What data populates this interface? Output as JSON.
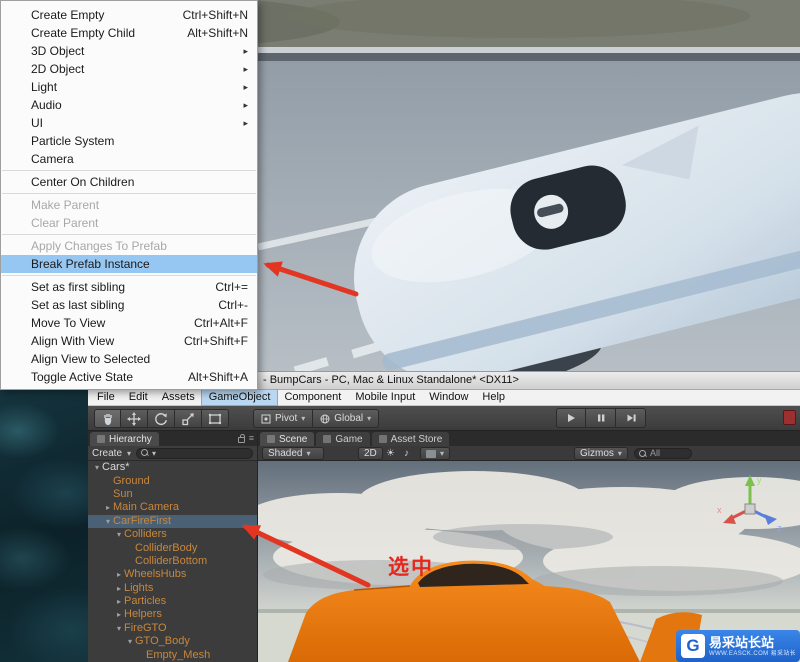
{
  "window": {
    "title": "- BumpCars - PC, Mac & Linux Standalone* <DX11>"
  },
  "menu_bar": {
    "items": [
      "File",
      "Edit",
      "Assets",
      "GameObject",
      "Component",
      "Mobile Input",
      "Window",
      "Help"
    ],
    "active": "GameObject"
  },
  "context_menu": {
    "items": [
      {
        "label": "Create Empty",
        "shortcut": "Ctrl+Shift+N"
      },
      {
        "label": "Create Empty Child",
        "shortcut": "Alt+Shift+N"
      },
      {
        "label": "3D Object",
        "submenu": true
      },
      {
        "label": "2D Object",
        "submenu": true
      },
      {
        "label": "Light",
        "submenu": true
      },
      {
        "label": "Audio",
        "submenu": true
      },
      {
        "label": "UI",
        "submenu": true
      },
      {
        "label": "Particle System"
      },
      {
        "label": "Camera"
      },
      {
        "sep": true
      },
      {
        "label": "Center On Children"
      },
      {
        "sep": true
      },
      {
        "label": "Make Parent",
        "disabled": true
      },
      {
        "label": "Clear Parent",
        "disabled": true
      },
      {
        "sep": true
      },
      {
        "label": "Apply Changes To Prefab",
        "disabled": true
      },
      {
        "label": "Break Prefab Instance",
        "highlighted": true
      },
      {
        "sep": true
      },
      {
        "label": "Set as first sibling",
        "shortcut": "Ctrl+="
      },
      {
        "label": "Set as last sibling",
        "shortcut": "Ctrl+-"
      },
      {
        "label": "Move To View",
        "shortcut": "Ctrl+Alt+F"
      },
      {
        "label": "Align With View",
        "shortcut": "Ctrl+Shift+F"
      },
      {
        "label": "Align View to Selected"
      },
      {
        "label": "Toggle Active State",
        "shortcut": "Alt+Shift+A"
      }
    ]
  },
  "toolbar": {
    "pivot": "Pivot",
    "global": "Global"
  },
  "hierarchy": {
    "tab": "Hierarchy",
    "create_label": "Create",
    "items": [
      {
        "label": "Cars*",
        "indent": 0,
        "fold": "open",
        "root": true
      },
      {
        "label": "Ground",
        "indent": 1
      },
      {
        "label": "Sun",
        "indent": 1
      },
      {
        "label": "Main Camera",
        "indent": 1,
        "fold": "closed"
      },
      {
        "label": "CarFireFirst",
        "indent": 1,
        "fold": "open",
        "selected": true
      },
      {
        "label": "Colliders",
        "indent": 2,
        "fold": "open"
      },
      {
        "label": "ColliderBody",
        "indent": 3
      },
      {
        "label": "ColliderBottom",
        "indent": 3
      },
      {
        "label": "WheelsHubs",
        "indent": 2,
        "fold": "closed"
      },
      {
        "label": "Lights",
        "indent": 2,
        "fold": "closed"
      },
      {
        "label": "Particles",
        "indent": 2,
        "fold": "closed"
      },
      {
        "label": "Helpers",
        "indent": 2,
        "fold": "closed"
      },
      {
        "label": "FireGTO",
        "indent": 2,
        "fold": "open"
      },
      {
        "label": "GTO_Body",
        "indent": 3,
        "fold": "open"
      },
      {
        "label": "Empty_Mesh",
        "indent": 4
      }
    ]
  },
  "scene_panel": {
    "tabs": [
      "Scene",
      "Game",
      "Asset Store"
    ],
    "active_tab": "Scene",
    "shaded": "Shaded",
    "mode_2d": "2D",
    "gizmos": "Gizmos",
    "search": "All",
    "annotation": "选中",
    "axis": {
      "x": "x",
      "y": "y",
      "z": "z"
    }
  },
  "watermark": {
    "logo_letter": "G",
    "title": "易采站长站",
    "subtitle": "WWW.EASCK.COM 易采站长站"
  },
  "icons": {
    "submenu_arrow": "▸",
    "caret_down": "▾",
    "fold_open": "▾",
    "fold_closed": "▸",
    "sun": "☀",
    "audio": "♪",
    "panel_menu": "≡"
  },
  "colors": {
    "highlight_blue": "#96c7f2",
    "selection_row": "#4a6175",
    "arrow_red": "#e23522",
    "hierarchy_item_orange": "#c8873c"
  }
}
